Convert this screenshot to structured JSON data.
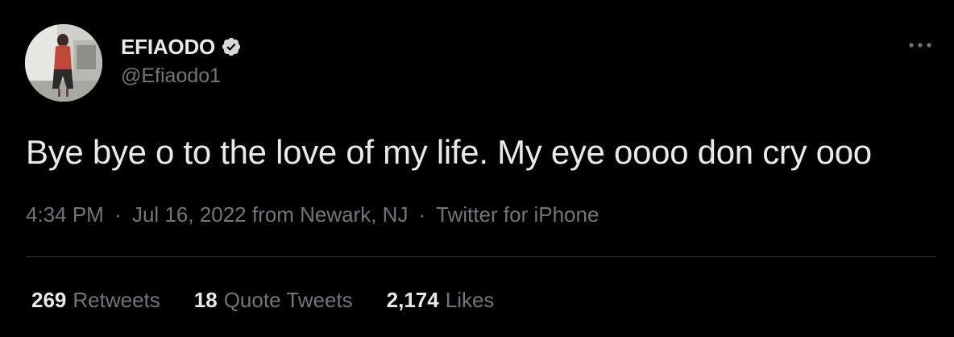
{
  "author": {
    "display_name": "EFIAODO",
    "handle": "@Efiaodo1",
    "verified_icon": "verified-badge-icon"
  },
  "tweet": {
    "text": "Bye bye o to the love of my life. My eye oooo don cry ooo",
    "time": "4:34 PM",
    "separator": "·",
    "date_location": "Jul 16, 2022 from Newark, NJ",
    "client": "Twitter for iPhone"
  },
  "stats": {
    "retweets": {
      "count": "269",
      "label": "Retweets"
    },
    "quotes": {
      "count": "18",
      "label": "Quote Tweets"
    },
    "likes": {
      "count": "2,174",
      "label": "Likes"
    }
  },
  "colors": {
    "background": "#000000",
    "primary_text": "#e7e9ea",
    "secondary_text": "#71767b",
    "divider": "#2f3336",
    "verified_badge": "#d9d9d9"
  }
}
